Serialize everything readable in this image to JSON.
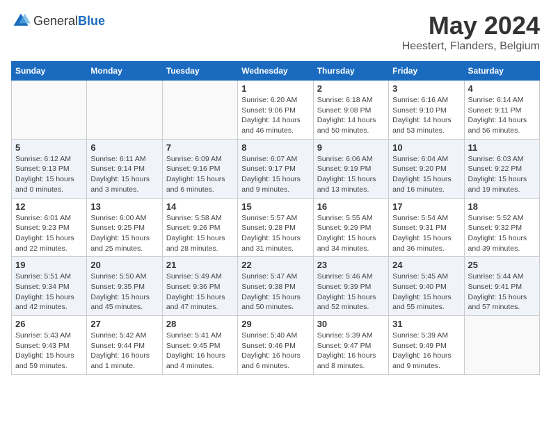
{
  "header": {
    "logo": {
      "general": "General",
      "blue": "Blue"
    },
    "title": "May 2024",
    "subtitle": "Heestert, Flanders, Belgium"
  },
  "weekdays": [
    "Sunday",
    "Monday",
    "Tuesday",
    "Wednesday",
    "Thursday",
    "Friday",
    "Saturday"
  ],
  "weeks": [
    [
      {
        "day": "",
        "info": ""
      },
      {
        "day": "",
        "info": ""
      },
      {
        "day": "",
        "info": ""
      },
      {
        "day": "1",
        "info": "Sunrise: 6:20 AM\nSunset: 9:06 PM\nDaylight: 14 hours\nand 46 minutes."
      },
      {
        "day": "2",
        "info": "Sunrise: 6:18 AM\nSunset: 9:08 PM\nDaylight: 14 hours\nand 50 minutes."
      },
      {
        "day": "3",
        "info": "Sunrise: 6:16 AM\nSunset: 9:10 PM\nDaylight: 14 hours\nand 53 minutes."
      },
      {
        "day": "4",
        "info": "Sunrise: 6:14 AM\nSunset: 9:11 PM\nDaylight: 14 hours\nand 56 minutes."
      }
    ],
    [
      {
        "day": "5",
        "info": "Sunrise: 6:12 AM\nSunset: 9:13 PM\nDaylight: 15 hours\nand 0 minutes."
      },
      {
        "day": "6",
        "info": "Sunrise: 6:11 AM\nSunset: 9:14 PM\nDaylight: 15 hours\nand 3 minutes."
      },
      {
        "day": "7",
        "info": "Sunrise: 6:09 AM\nSunset: 9:16 PM\nDaylight: 15 hours\nand 6 minutes."
      },
      {
        "day": "8",
        "info": "Sunrise: 6:07 AM\nSunset: 9:17 PM\nDaylight: 15 hours\nand 9 minutes."
      },
      {
        "day": "9",
        "info": "Sunrise: 6:06 AM\nSunset: 9:19 PM\nDaylight: 15 hours\nand 13 minutes."
      },
      {
        "day": "10",
        "info": "Sunrise: 6:04 AM\nSunset: 9:20 PM\nDaylight: 15 hours\nand 16 minutes."
      },
      {
        "day": "11",
        "info": "Sunrise: 6:03 AM\nSunset: 9:22 PM\nDaylight: 15 hours\nand 19 minutes."
      }
    ],
    [
      {
        "day": "12",
        "info": "Sunrise: 6:01 AM\nSunset: 9:23 PM\nDaylight: 15 hours\nand 22 minutes."
      },
      {
        "day": "13",
        "info": "Sunrise: 6:00 AM\nSunset: 9:25 PM\nDaylight: 15 hours\nand 25 minutes."
      },
      {
        "day": "14",
        "info": "Sunrise: 5:58 AM\nSunset: 9:26 PM\nDaylight: 15 hours\nand 28 minutes."
      },
      {
        "day": "15",
        "info": "Sunrise: 5:57 AM\nSunset: 9:28 PM\nDaylight: 15 hours\nand 31 minutes."
      },
      {
        "day": "16",
        "info": "Sunrise: 5:55 AM\nSunset: 9:29 PM\nDaylight: 15 hours\nand 34 minutes."
      },
      {
        "day": "17",
        "info": "Sunrise: 5:54 AM\nSunset: 9:31 PM\nDaylight: 15 hours\nand 36 minutes."
      },
      {
        "day": "18",
        "info": "Sunrise: 5:52 AM\nSunset: 9:32 PM\nDaylight: 15 hours\nand 39 minutes."
      }
    ],
    [
      {
        "day": "19",
        "info": "Sunrise: 5:51 AM\nSunset: 9:34 PM\nDaylight: 15 hours\nand 42 minutes."
      },
      {
        "day": "20",
        "info": "Sunrise: 5:50 AM\nSunset: 9:35 PM\nDaylight: 15 hours\nand 45 minutes."
      },
      {
        "day": "21",
        "info": "Sunrise: 5:49 AM\nSunset: 9:36 PM\nDaylight: 15 hours\nand 47 minutes."
      },
      {
        "day": "22",
        "info": "Sunrise: 5:47 AM\nSunset: 9:38 PM\nDaylight: 15 hours\nand 50 minutes."
      },
      {
        "day": "23",
        "info": "Sunrise: 5:46 AM\nSunset: 9:39 PM\nDaylight: 15 hours\nand 52 minutes."
      },
      {
        "day": "24",
        "info": "Sunrise: 5:45 AM\nSunset: 9:40 PM\nDaylight: 15 hours\nand 55 minutes."
      },
      {
        "day": "25",
        "info": "Sunrise: 5:44 AM\nSunset: 9:41 PM\nDaylight: 15 hours\nand 57 minutes."
      }
    ],
    [
      {
        "day": "26",
        "info": "Sunrise: 5:43 AM\nSunset: 9:43 PM\nDaylight: 15 hours\nand 59 minutes."
      },
      {
        "day": "27",
        "info": "Sunrise: 5:42 AM\nSunset: 9:44 PM\nDaylight: 16 hours\nand 1 minute."
      },
      {
        "day": "28",
        "info": "Sunrise: 5:41 AM\nSunset: 9:45 PM\nDaylight: 16 hours\nand 4 minutes."
      },
      {
        "day": "29",
        "info": "Sunrise: 5:40 AM\nSunset: 9:46 PM\nDaylight: 16 hours\nand 6 minutes."
      },
      {
        "day": "30",
        "info": "Sunrise: 5:39 AM\nSunset: 9:47 PM\nDaylight: 16 hours\nand 8 minutes."
      },
      {
        "day": "31",
        "info": "Sunrise: 5:39 AM\nSunset: 9:49 PM\nDaylight: 16 hours\nand 9 minutes."
      },
      {
        "day": "",
        "info": ""
      }
    ]
  ]
}
